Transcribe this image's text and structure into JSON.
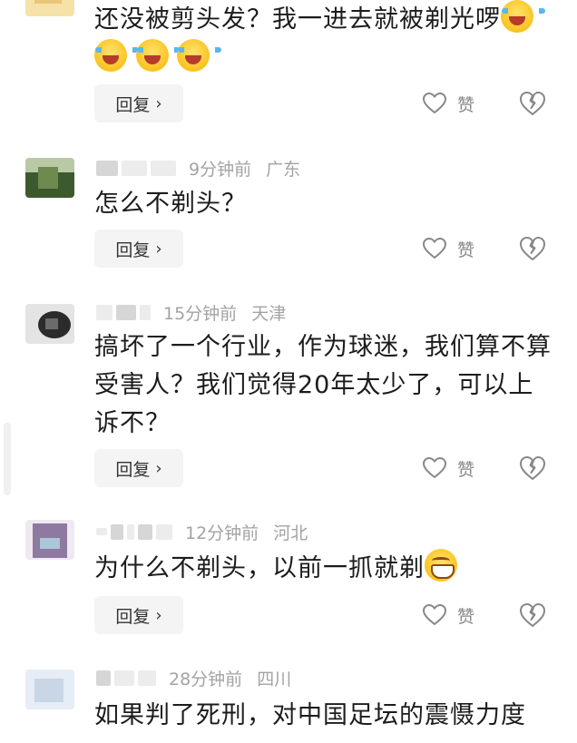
{
  "reply_label": "回复",
  "like_label": "赞",
  "comments": [
    {
      "time": "",
      "location": "",
      "text": "还没被剪头发？我一进去就被剃光啰"
    },
    {
      "time": "9分钟前",
      "location": "广东",
      "text": "怎么不剃头？"
    },
    {
      "time": "15分钟前",
      "location": "天津",
      "text": "搞坏了一个行业，作为球迷，我们算不算受害人？我们觉得20年太少了，可以上诉不？"
    },
    {
      "time": "12分钟前",
      "location": "河北",
      "text": "为什么不剃头，以前一抓就剃"
    },
    {
      "time": "28分钟前",
      "location": "四川",
      "text": "如果判了死刑，对中国足坛的震慑力度"
    }
  ],
  "colors": {
    "meta_gray": "#a3a3a3",
    "reply_bg": "#f4f4f4",
    "text": "#1c1c1c"
  }
}
